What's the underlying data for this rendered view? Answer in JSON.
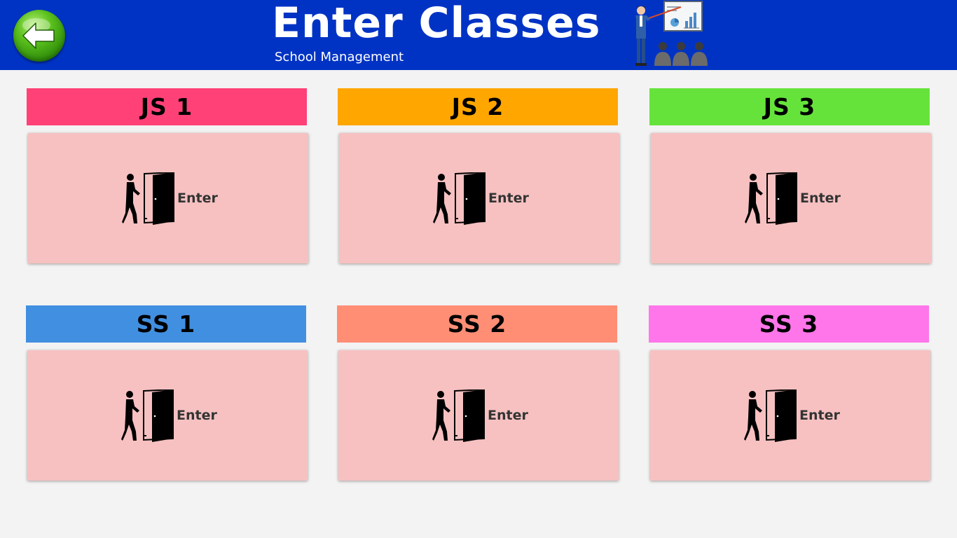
{
  "header": {
    "title": "Enter Classes",
    "subtitle": "School Management",
    "background_color": "#0033c4",
    "back_icon": "back-arrow-icon",
    "illustration_icon": "teacher-presentation-icon"
  },
  "classes": [
    {
      "name": "JS 1",
      "color": "#ff4177",
      "button_label": "Enter",
      "icon": "enter-door-icon"
    },
    {
      "name": "JS 2",
      "color": "#ffa600",
      "button_label": "Enter",
      "icon": "enter-door-icon"
    },
    {
      "name": "JS 3",
      "color": "#66e33b",
      "button_label": "Enter",
      "icon": "enter-door-icon"
    },
    {
      "name": "SS 1",
      "color": "#418fe0",
      "button_label": "Enter",
      "icon": "enter-door-icon"
    },
    {
      "name": "SS 2",
      "color": "#ff8e75",
      "button_label": "Enter",
      "icon": "enter-door-icon"
    },
    {
      "name": "SS 3",
      "color": "#ff75ea",
      "button_label": "Enter",
      "icon": "enter-door-icon"
    }
  ],
  "card_color": "#f7c1c1"
}
